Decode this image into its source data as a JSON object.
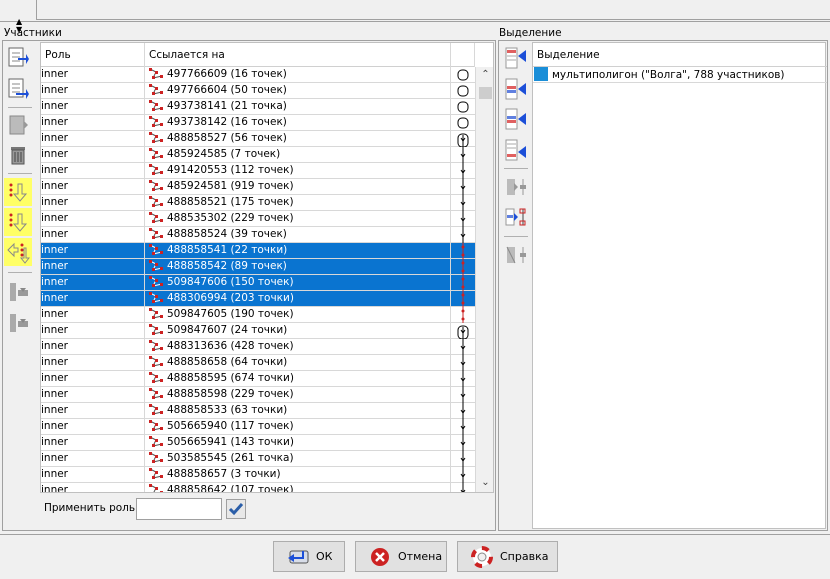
{
  "members": {
    "title": "Участники",
    "columns": {
      "role": "Роль",
      "ref": "Ссылается на"
    },
    "rows": [
      {
        "role": "inner",
        "ref": "497766609 (16 точек)",
        "selected": false,
        "conn": "ring"
      },
      {
        "role": "inner",
        "ref": "497766604 (50 точек)",
        "selected": false,
        "conn": "ring"
      },
      {
        "role": "inner",
        "ref": "493738141 (21 точка)",
        "selected": false,
        "conn": "ring"
      },
      {
        "role": "inner",
        "ref": "493738142 (16 точек)",
        "selected": false,
        "conn": "ring"
      },
      {
        "role": "inner",
        "ref": "488858527 (56 точек)",
        "selected": false,
        "conn": "line"
      },
      {
        "role": "inner",
        "ref": "485924585 (7 точек)",
        "selected": false,
        "conn": "line"
      },
      {
        "role": "inner",
        "ref": "491420553 (112 точек)",
        "selected": false,
        "conn": "line"
      },
      {
        "role": "inner",
        "ref": "485924581 (919 точек)",
        "selected": false,
        "conn": "line"
      },
      {
        "role": "inner",
        "ref": "488858521 (175 точек)",
        "selected": false,
        "conn": "line"
      },
      {
        "role": "inner",
        "ref": "488535302 (229 точек)",
        "selected": false,
        "conn": "line"
      },
      {
        "role": "inner",
        "ref": "488858524 (39 точек)",
        "selected": false,
        "conn": "line"
      },
      {
        "role": "inner",
        "ref": "488858541 (22 точки)",
        "selected": true,
        "conn": "red"
      },
      {
        "role": "inner",
        "ref": "488858542 (89 точек)",
        "selected": true,
        "conn": "red"
      },
      {
        "role": "inner",
        "ref": "509847606 (150 точек)",
        "selected": true,
        "conn": "red"
      },
      {
        "role": "inner",
        "ref": "488306994 (203 точки)",
        "selected": true,
        "conn": "red"
      },
      {
        "role": "inner",
        "ref": "509847605 (190 точек)",
        "selected": false,
        "conn": "red"
      },
      {
        "role": "inner",
        "ref": "509847607 (24 точки)",
        "selected": false,
        "conn": "line"
      },
      {
        "role": "inner",
        "ref": "488313636 (428 точек)",
        "selected": false,
        "conn": "line"
      },
      {
        "role": "inner",
        "ref": "488858658 (64 точки)",
        "selected": false,
        "conn": "line"
      },
      {
        "role": "inner",
        "ref": "488858595 (674 точки)",
        "selected": false,
        "conn": "line"
      },
      {
        "role": "inner",
        "ref": "488858598 (229 точек)",
        "selected": false,
        "conn": "line"
      },
      {
        "role": "inner",
        "ref": "488858533 (63 точки)",
        "selected": false,
        "conn": "line"
      },
      {
        "role": "inner",
        "ref": "505665940 (117 точек)",
        "selected": false,
        "conn": "line"
      },
      {
        "role": "inner",
        "ref": "505665941 (143 точки)",
        "selected": false,
        "conn": "line"
      },
      {
        "role": "inner",
        "ref": "503585545 (261 точка)",
        "selected": false,
        "conn": "line"
      },
      {
        "role": "inner",
        "ref": "488858657 (3 точки)",
        "selected": false,
        "conn": "line"
      },
      {
        "role": "inner",
        "ref": "488858642 (107 точек)",
        "selected": false,
        "conn": "line"
      }
    ],
    "apply_role_label": "Применить роль:",
    "apply_role_value": ""
  },
  "selection": {
    "title": "Выделение",
    "column": "Выделение",
    "item": "мультиполигон (\"Волга\", 788 участников)",
    "item_color": "#1a8ed8"
  },
  "colors": {
    "selected_row": "#0a74d0",
    "highlight": "#ffff66",
    "accent_blue": "#1c4fd8",
    "accent_red": "#cc2222"
  },
  "buttons": {
    "ok": "ОК",
    "cancel": "Отмена",
    "help": "Справка"
  }
}
